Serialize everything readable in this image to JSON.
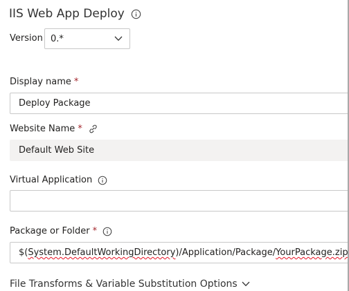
{
  "task": {
    "title": "IIS Web App Deploy",
    "version_label": "Version",
    "version_value": "0.*"
  },
  "fields": {
    "display_name": {
      "label": "Display name",
      "required_mark": "*",
      "value": "Deploy Package"
    },
    "website_name": {
      "label": "Website Name",
      "required_mark": "*",
      "value": "Default Web Site"
    },
    "virtual_application": {
      "label": "Virtual Application",
      "value": ""
    },
    "package_or_folder": {
      "label": "Package or Folder",
      "required_mark": "*",
      "value_prefix": "$(",
      "value_var": "System.DefaultWorkingDirectory",
      "value_mid": ")/Application/Package/",
      "value_file": "YourPackage.zip"
    }
  },
  "sections": {
    "file_transforms_label": "File Transforms & Variable Substitution Options"
  },
  "icons": {
    "info": "info-icon",
    "link": "link-icon",
    "chevron": "chevron-down-icon"
  },
  "colors": {
    "required": "#a4262c",
    "spellcheck_underline": "#e81123",
    "readonly_background": "#f3f2f1"
  }
}
